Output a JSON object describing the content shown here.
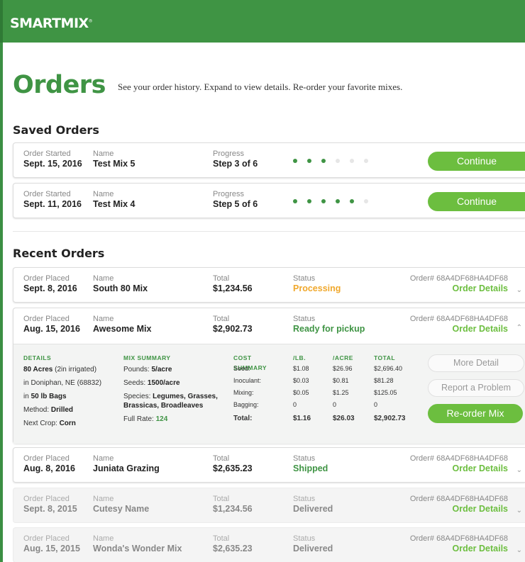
{
  "brand": {
    "logo": "SMARTMIX",
    "mark": "®"
  },
  "header": {
    "title": "Orders",
    "subtitle": "See your order history. Expand to view details. Re-order your favorite mixes."
  },
  "saved": {
    "title": "Saved Orders",
    "orders": [
      {
        "started_label": "Order Started",
        "started": "Sept. 15, 2016",
        "name_label": "Name",
        "name": "Test Mix 5",
        "progress_label": "Progress",
        "progress": "Step 3 of 6",
        "steps_done": 3,
        "steps_total": 6,
        "button": "Continue"
      },
      {
        "started_label": "Order Started",
        "started": "Sept. 11, 2016",
        "name_label": "Name",
        "name": "Test Mix 4",
        "progress_label": "Progress",
        "progress": "Step 5 of 6",
        "steps_done": 5,
        "steps_total": 6,
        "button": "Continue"
      }
    ]
  },
  "recent": {
    "title": "Recent Orders",
    "orders": [
      {
        "placed_label": "Order Placed",
        "placed": "Sept. 8, 2016",
        "name_label": "Name",
        "name": "South 80 Mix",
        "total_label": "Total",
        "total": "$1,234.56",
        "status_label": "Status",
        "status": "Processing",
        "order_no": "Order# 68A4DF68HA4DF68",
        "details_link": "Order Details"
      },
      {
        "placed_label": "Order Placed",
        "placed": "Aug. 15, 2016",
        "name_label": "Name",
        "name": "Awesome Mix",
        "total_label": "Total",
        "total": "$2,902.73",
        "status_label": "Status",
        "status": "Ready for pickup",
        "order_no": "Order# 68A4DF68HA4DF68",
        "details_link": "Order Details"
      },
      {
        "placed_label": "Order Placed",
        "placed": "Aug. 8, 2016",
        "name_label": "Name",
        "name": "Juniata Grazing",
        "total_label": "Total",
        "total": "$2,635.23",
        "status_label": "Status",
        "status": "Shipped",
        "order_no": "Order# 68A4DF68HA4DF68",
        "details_link": "Order Details"
      },
      {
        "placed_label": "Order Placed",
        "placed": "Sept. 8, 2015",
        "name_label": "Name",
        "name": "Cutesy Name",
        "total_label": "Total",
        "total": "$1,234.56",
        "status_label": "Status",
        "status": "Delivered",
        "order_no": "Order# 68A4DF68HA4DF68",
        "details_link": "Order Details"
      },
      {
        "placed_label": "Order Placed",
        "placed": "Aug. 15, 2015",
        "name_label": "Name",
        "name": "Wonda's Wonder Mix",
        "total_label": "Total",
        "total": "$2,635.23",
        "status_label": "Status",
        "status": "Delivered",
        "order_no": "Order# 68A4DF68HA4DF68",
        "details_link": "Order Details"
      }
    ]
  },
  "expanded": {
    "details_head": "DETAILS",
    "acres": "80 Acres",
    "acres_note": "(2in irrigated)",
    "location_prefix": "in Doniphan, NE (68832)",
    "bags_prefix": "in",
    "bags": "50 lb Bags",
    "method_label": "Method:",
    "method": "Drilled",
    "next_crop_label": "Next Crop:",
    "next_crop": "Corn",
    "mix_head": "MIX SUMMARY",
    "pounds_label": "Pounds:",
    "pounds": "5/acre",
    "seeds_label": "Seeds:",
    "seeds": "1500/acre",
    "species_label": "Species:",
    "species_1": "Legumes, Grasses,",
    "species_2": "Brassicas, Broadleaves",
    "full_rate_label": "Full Rate:",
    "full_rate": "124",
    "cost_head": "COST SUMMARY",
    "cost_cols": [
      "/LB.",
      "/ACRE",
      "TOTAL"
    ],
    "cost_rows": [
      {
        "label": "Seed:",
        "lb": "$1.08",
        "acre": "$26.96",
        "total": "$2,696.40"
      },
      {
        "label": "Inoculant:",
        "lb": "$0.03",
        "acre": "$0.81",
        "total": "$81.28"
      },
      {
        "label": "Mixing:",
        "lb": "$0.05",
        "acre": "$1.25",
        "total": "$125.05"
      },
      {
        "label": "Bagging:",
        "lb": "0",
        "acre": "0",
        "total": "0"
      }
    ],
    "cost_total": {
      "label": "Total:",
      "lb": "$1.16",
      "acre": "$26.03",
      "total": "$2,902.73"
    },
    "btn_more": "More Detail",
    "btn_report": "Report a Problem",
    "btn_reorder": "Re-order Mix"
  },
  "colors": {
    "brand_green": "#3f9444",
    "button_green": "#6cbe3f",
    "processing": "#f0a82c"
  }
}
